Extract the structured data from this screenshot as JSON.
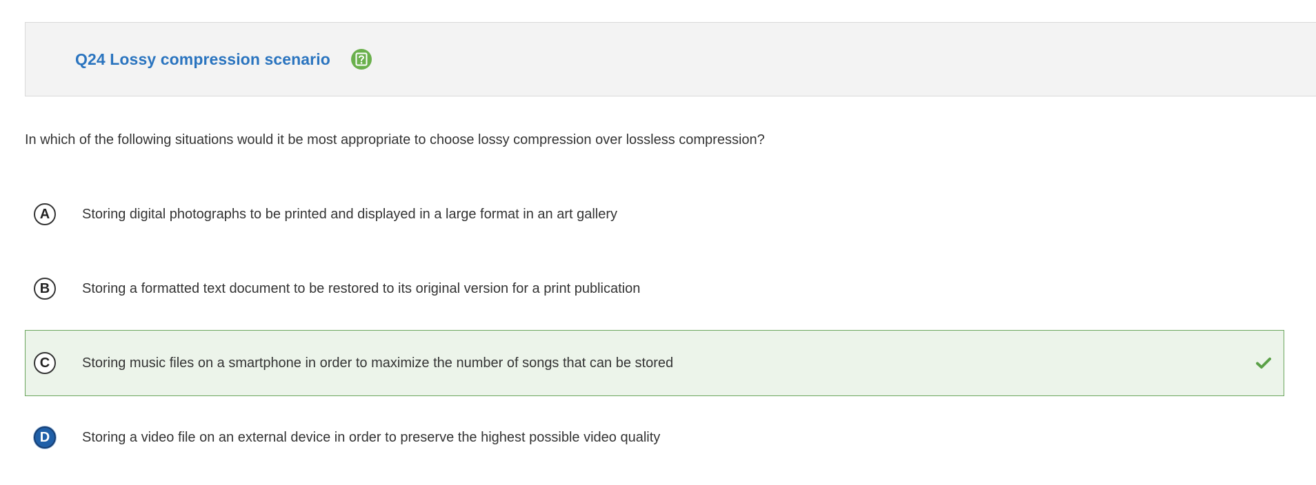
{
  "question": {
    "title": "Q24 Lossy compression scenario",
    "help_icon": "help-question-icon",
    "prompt": "In which of the following situations would it be most appropriate to choose lossy compression over lossless compression?"
  },
  "options": [
    {
      "letter": "A",
      "text": "Storing digital photographs to be printed and displayed in a large format in an art gallery",
      "state": "unselected"
    },
    {
      "letter": "B",
      "text": "Storing a formatted text document to be restored to its original version for a print publication",
      "state": "unselected"
    },
    {
      "letter": "C",
      "text": "Storing music files on a smartphone in order to maximize the number of songs that can be stored",
      "state": "correct",
      "status_icon": "checkmark-icon"
    },
    {
      "letter": "D",
      "text": "Storing a video file on an external device in order to preserve the highest possible video quality",
      "state": "selected"
    }
  ],
  "colors": {
    "title": "#2a74bf",
    "help_icon_bg": "#6ab04c",
    "correct_bg": "#ecf4ea",
    "correct_border": "#6aa55c",
    "checkmark": "#5aa047",
    "selected_letter_bg": "#1f5fa8"
  }
}
